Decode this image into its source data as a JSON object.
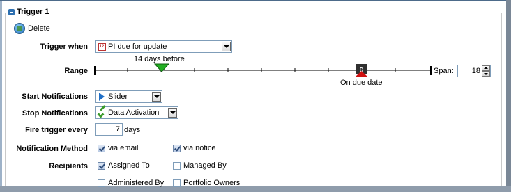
{
  "panel": {
    "title": "Trigger 1",
    "delete_label": "Delete"
  },
  "trigger_when": {
    "label": "Trigger when",
    "value": "PI due for update",
    "calendar_text": "12"
  },
  "range": {
    "label": "Range",
    "start_marker_label": "14 days before",
    "due_marker_label": "On due date",
    "due_marker_letter": "D",
    "span_label": "Span:",
    "span_value": "18"
  },
  "start_notifications": {
    "label": "Start Notifications",
    "value": "Slider"
  },
  "stop_notifications": {
    "label": "Stop Notifications",
    "value": "Data Activation"
  },
  "fire_trigger": {
    "label": "Fire trigger every",
    "value": "7",
    "unit": "days"
  },
  "notification_method": {
    "label": "Notification Method",
    "options": [
      {
        "label": "via email",
        "checked": true
      },
      {
        "label": "via notice",
        "checked": true
      }
    ]
  },
  "recipients": {
    "label": "Recipients",
    "options": [
      {
        "label": "Assigned To",
        "checked": true
      },
      {
        "label": "Managed By",
        "checked": false
      },
      {
        "label": "Administered By",
        "checked": false
      },
      {
        "label": "Portfolio Owners",
        "checked": false
      }
    ]
  },
  "colors": {
    "start_marker": "#22b022",
    "due_marker": "#d01010",
    "due_box": "#303030"
  }
}
